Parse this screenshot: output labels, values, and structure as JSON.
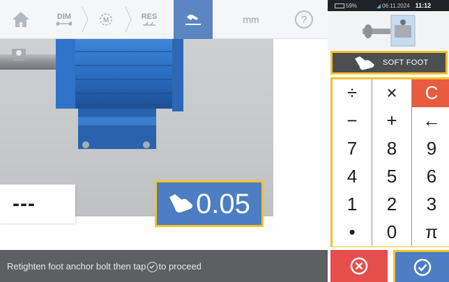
{
  "toolbar": {
    "home_icon": "home-icon",
    "dim_label": "DIM",
    "measure_icon": "measure-icon",
    "res_label": "RES",
    "softfoot_icon": "soft-foot-icon",
    "unit_label": "mm",
    "help_label": "?"
  },
  "scene": {
    "left_readout": "---",
    "value": "0.05",
    "value_icon": "hand-pointer-icon"
  },
  "status": {
    "text_before": "Retighten foot anchor bolt then tap",
    "text_after": "to proceed"
  },
  "system": {
    "battery": "59%",
    "date": "06.11.2024",
    "time": "11:12"
  },
  "panel": {
    "mode_label": "SOFT FOOT"
  },
  "keypad": {
    "keys": [
      "÷",
      "×",
      "C",
      "−",
      "+",
      "←",
      "7",
      "8",
      "9",
      "4",
      "5",
      "6",
      "1",
      "2",
      "3",
      "•",
      "0",
      "π"
    ]
  },
  "actions": {
    "cancel_icon": "cancel-icon",
    "confirm_icon": "confirm-icon"
  },
  "colors": {
    "accent_blue": "#4d7dc2",
    "highlight_yellow": "#f2c22d",
    "clear_red": "#e85b3f",
    "cancel_red": "#e64e4b",
    "status_gray": "#5d5f61"
  }
}
